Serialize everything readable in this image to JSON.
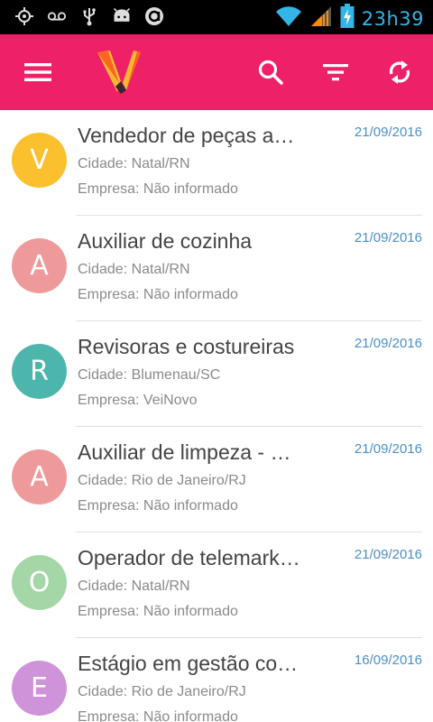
{
  "status_bar": {
    "time": "23h39",
    "icons": [
      "gps-icon",
      "voicemail-icon",
      "usb-icon",
      "android-debug-icon",
      "app-notification-icon",
      "wifi-icon",
      "signal-icon",
      "battery-charging-icon"
    ]
  },
  "app_bar": {
    "logo_letter": "V",
    "actions": [
      "menu-icon",
      "search-icon",
      "filter-icon",
      "refresh-icon"
    ]
  },
  "jobs": [
    {
      "letter": "V",
      "color": "#fbc02d",
      "title": "Vendedor de peças a…",
      "date": "21/09/2016",
      "city": "Cidade: Natal/RN",
      "company": "Empresa: Não informado"
    },
    {
      "letter": "A",
      "color": "#ef9a9a",
      "title": "Auxiliar de cozinha",
      "date": "21/09/2016",
      "city": "Cidade: Natal/RN",
      "company": "Empresa: Não informado"
    },
    {
      "letter": "R",
      "color": "#4db6ac",
      "title": "Revisoras e costureiras",
      "date": "21/09/2016",
      "city": "Cidade: Blumenau/SC",
      "company": "Empresa: VeiNovo"
    },
    {
      "letter": "A",
      "color": "#ef9a9a",
      "title": "Auxiliar de limpeza - …",
      "date": "21/09/2016",
      "city": "Cidade: Rio de Janeiro/RJ",
      "company": "Empresa: Não informado"
    },
    {
      "letter": "O",
      "color": "#a5d6a7",
      "title": "Operador de telemark…",
      "date": "21/09/2016",
      "city": "Cidade: Natal/RN",
      "company": "Empresa: Não informado"
    },
    {
      "letter": "E",
      "color": "#ce93d8",
      "title": "Estágio em gestão co…",
      "date": "16/09/2016",
      "city": "Cidade: Rio de Janeiro/RJ",
      "company": "Empresa: Não informado"
    }
  ]
}
